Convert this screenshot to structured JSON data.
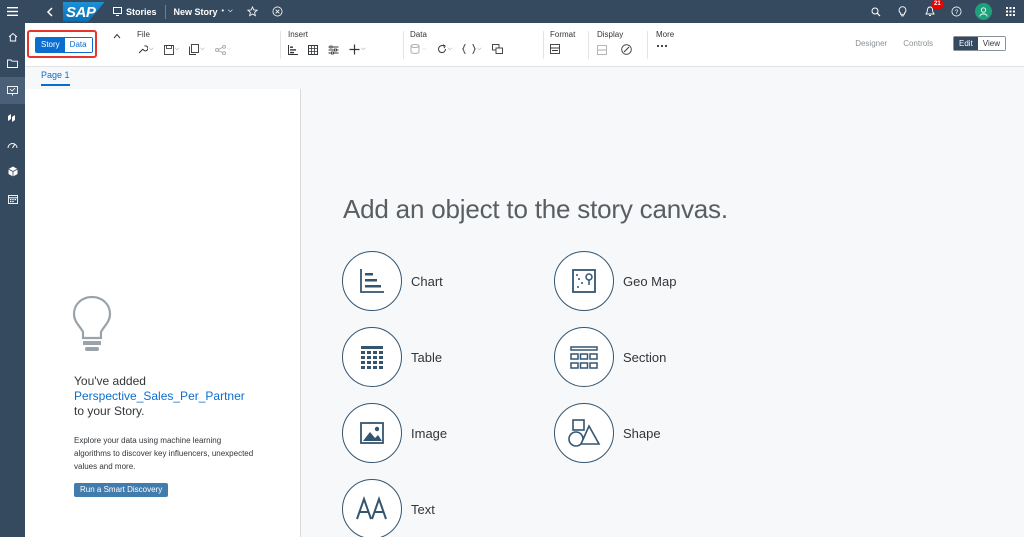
{
  "shell": {
    "stories_label": "Stories",
    "story_name": "New Story",
    "story_dirty_marker": "•",
    "notification_count": "21"
  },
  "toolbar": {
    "mode_story": "Story",
    "mode_data": "Data",
    "groups": {
      "file": "File",
      "insert": "Insert",
      "data": "Data",
      "format": "Format",
      "display": "Display",
      "more": "More"
    },
    "designer": "Designer",
    "controls": "Controls",
    "edit": "Edit",
    "view": "View"
  },
  "page_tab": "Page 1",
  "left_panel": {
    "added_prefix": "You've added",
    "dataset_name": "Perspective_Sales_Per_Partner",
    "added_suffix": "to your Story.",
    "description": "Explore your data using machine learning algorithms to discover key influencers, unexpected values and more.",
    "button": "Run a Smart Discovery"
  },
  "canvas": {
    "title": "Add an object to the story canvas.",
    "objects": {
      "chart": "Chart",
      "geomap": "Geo Map",
      "table": "Table",
      "section": "Section",
      "image": "Image",
      "shape": "Shape",
      "text": "Text"
    }
  },
  "colors": {
    "shell": "#354a5f",
    "accent": "#0a6ed1",
    "highlight": "#e8352b"
  }
}
